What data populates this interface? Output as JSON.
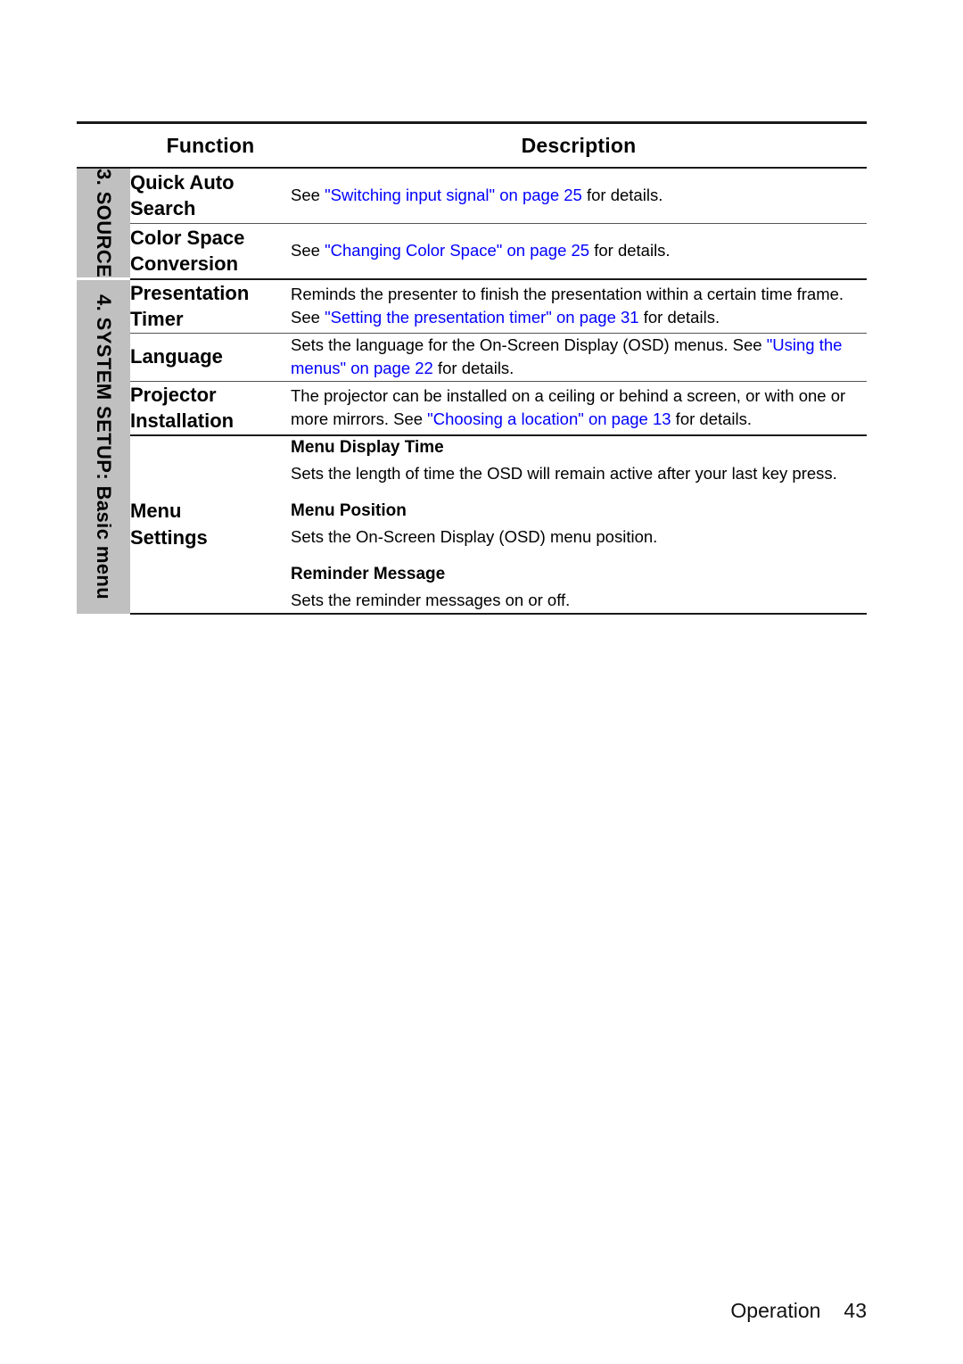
{
  "page": {
    "footer_label": "Operation",
    "footer_page_number": "43",
    "link_color": "#0000FF",
    "group_band_color": "#C0C0C0"
  },
  "table": {
    "headers": {
      "function": "Function",
      "description": "Description"
    },
    "groups": [
      {
        "id": "source",
        "label": "3. SOURCE"
      },
      {
        "id": "system-setup",
        "label": "4. SYSTEM SETUP: Basic menu"
      }
    ],
    "rows": [
      {
        "function_line1": "Quick Auto",
        "function_line2": "Search",
        "description_pre": "See ",
        "description_link": "\"Switching input signal\" on page 25",
        "description_post": " for details."
      },
      {
        "function_line1": "Color Space",
        "function_line2": "Conversion",
        "description_pre": "See ",
        "description_link": "\"Changing Color Space\" on page 25",
        "description_post": " for details."
      },
      {
        "function_line1": "Presentation",
        "function_line2": "Timer",
        "description_pre": "Reminds the presenter to finish the presentation within a certain time frame. See ",
        "description_link": "\"Setting the presentation timer\" on page 31",
        "description_post": " for details."
      },
      {
        "function_line1": "Language",
        "function_line2": "",
        "description_pre": "Sets the language for the On-Screen Display (OSD) menus. See ",
        "description_link": "\"Using the menus\" on page 22",
        "description_post": " for details."
      },
      {
        "function_line1": "Projector",
        "function_line2": "Installation",
        "description_pre": "The projector can be installed on a ceiling or behind a screen, or with one or more mirrors. See ",
        "description_link": "\"Choosing a location\" on page 13",
        "description_post": " for details."
      }
    ],
    "menu_settings_row": {
      "function_line1": "Menu",
      "function_line2": "Settings",
      "items": [
        {
          "heading": "Menu Display Time",
          "body": "Sets the length of time the OSD will remain active after your last key press."
        },
        {
          "heading": "Menu Position",
          "body": "Sets the On-Screen Display (OSD) menu position."
        },
        {
          "heading": "Reminder Message",
          "body": "Sets the reminder messages on or off."
        }
      ]
    }
  }
}
